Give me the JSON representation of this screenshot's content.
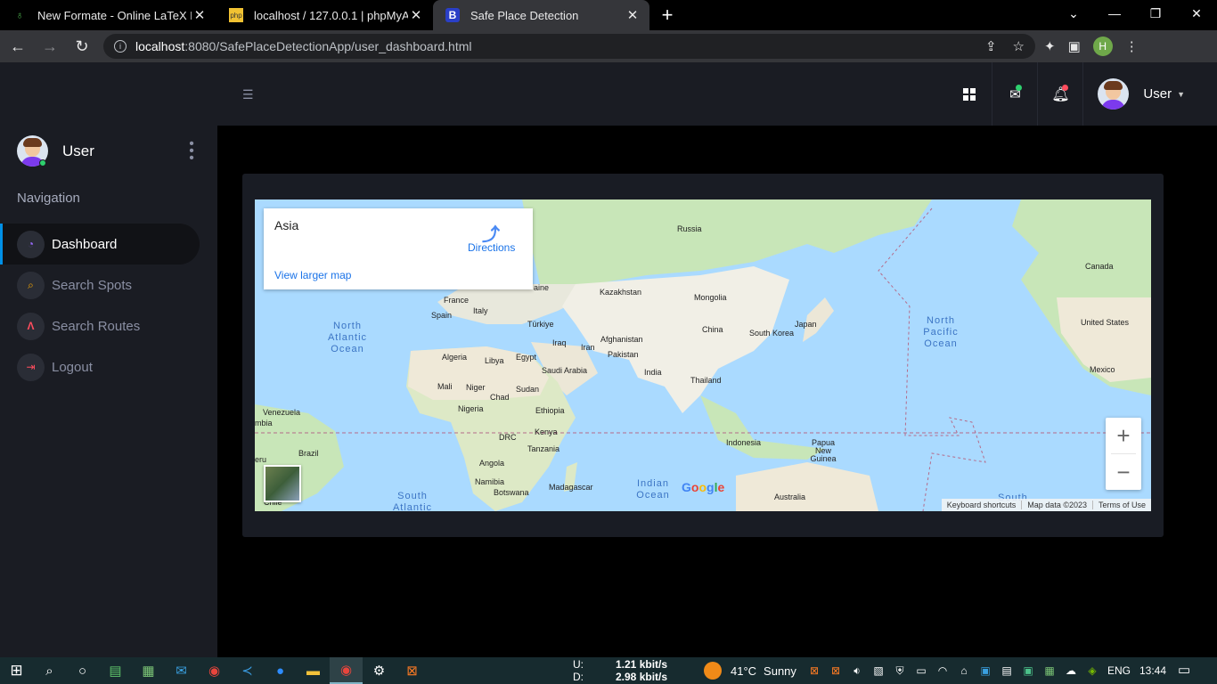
{
  "browser": {
    "tabs": [
      {
        "title": "New Formate - Online LaTeX Edit",
        "favicon": "overleaf-icon"
      },
      {
        "title": "localhost / 127.0.0.1 | phpMyAdm",
        "favicon": "phpmyadmin-icon"
      },
      {
        "title": "Safe Place Detection",
        "favicon": "bootstrap-icon"
      }
    ],
    "url_host": "localhost",
    "url_path": ":8080/SafePlaceDetectionApp/user_dashboard.html",
    "profile_initial": "H"
  },
  "header": {
    "user_name": "User"
  },
  "sidebar": {
    "user_name": "User",
    "nav_title": "Navigation",
    "items": [
      {
        "label": "Dashboard",
        "icon": "speedometer-icon",
        "color": "#9b6bff",
        "active": true
      },
      {
        "label": "Search Spots",
        "icon": "search-spots-icon",
        "color": "#f7a700",
        "active": false
      },
      {
        "label": "Search Routes",
        "icon": "route-icon",
        "color": "#ff4d5e",
        "active": false
      },
      {
        "label": "Logout",
        "icon": "logout-icon",
        "color": "#ff4d5e",
        "active": false
      }
    ]
  },
  "map": {
    "place": "Asia",
    "directions": "Directions",
    "view_larger": "View larger map",
    "labels": {
      "russia": "Russia",
      "canada": "Canada",
      "kazakhstan": "Kazakhstan",
      "mongolia": "Mongolia",
      "china": "China",
      "japan": "Japan",
      "south_korea": "South Korea",
      "united_states": "United States",
      "mexico": "Mexico",
      "france": "France",
      "spain": "Spain",
      "italy": "Italy",
      "turkiye": "Türkiye",
      "iraq": "Iraq",
      "iran": "Iran",
      "afghanistan": "Afghanistan",
      "pakistan": "Pakistan",
      "algeria": "Algeria",
      "libya": "Libya",
      "egypt": "Egypt",
      "saudi_arabia": "Saudi Arabia",
      "india": "India",
      "thailand": "Thailand",
      "mali": "Mali",
      "niger": "Niger",
      "chad": "Chad",
      "sudan": "Sudan",
      "nigeria": "Nigeria",
      "ethiopia": "Ethiopia",
      "venezuela": "Venezuela",
      "kenya": "Kenya",
      "drc": "DRC",
      "tanzania": "Tanzania",
      "indonesia": "Indonesia",
      "png": "Papua New Guinea",
      "brazil": "Brazil",
      "angola": "Angola",
      "namibia": "Namibia",
      "madagascar": "Madagascar",
      "botswana": "Botswana",
      "australia": "Australia",
      "chile": "Chile",
      "aine": "aine",
      "mbia": "mbia",
      "eru": "eru"
    },
    "oceans": {
      "north_atlantic": "North Atlantic Ocean",
      "north_pacific": "North Pacific Ocean",
      "indian": "Indian Ocean",
      "south_atlantic": "South Atlantic",
      "south": "South"
    },
    "google": "Google",
    "attribution": [
      "Keyboard shortcuts",
      "Map data ©2023",
      "Terms of Use"
    ],
    "zoom_in": "+",
    "zoom_out": "−"
  },
  "taskbar": {
    "upload_label": "U:",
    "upload_value": "1.21 kbit/s",
    "download_label": "D:",
    "download_value": "2.98 kbit/s",
    "temperature": "41°C",
    "weather": "Sunny",
    "language": "ENG",
    "time": "13:44"
  }
}
